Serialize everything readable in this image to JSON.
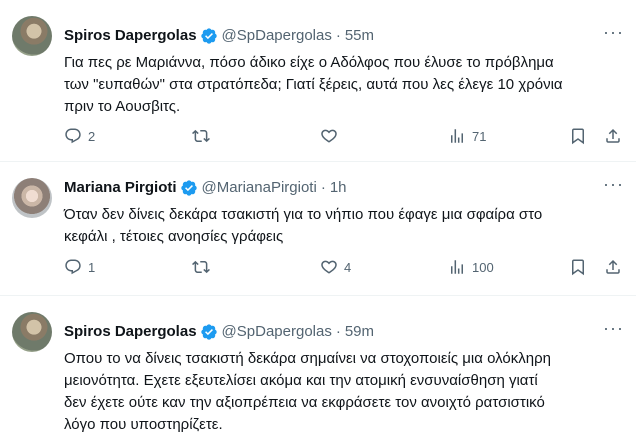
{
  "tweets": [
    {
      "name": "Spiros Dapergolas",
      "handle": "@SpDapergolas",
      "separator": "·",
      "time": "55m",
      "text": "Για πες ρε Μαριάννα, πόσο άδικο είχε ο Αδόλφος που έλυσε το πρόβλημα\nτων \"ευπαθών\" στα στρατόπεδα; Γιατί ξέρεις, αυτά που λες έλεγε 10 χρόνια\nπριν το Αουσβιτς.",
      "replies": "2",
      "retweets": "",
      "likes": "",
      "views": "71"
    },
    {
      "name": "Mariana Pirgioti",
      "handle": "@MarianaPirgioti",
      "separator": "·",
      "time": "1h",
      "text": "Όταν  δεν δίνεις δεκάρα τσακιστή για το νήπιο που έφαγε μια σφαίρα στο\nκεφάλι , τέτοιες ανοησίες γράφεις",
      "replies": "1",
      "retweets": "",
      "likes": "4",
      "views": "100"
    },
    {
      "name": "Spiros Dapergolas",
      "handle": "@SpDapergolas",
      "separator": "·",
      "time": "59m",
      "text": "Οπου το να δίνεις τσακιστή δεκάρα σημαίνει να στοχοποιείς μια ολόκληρη\nμειονότητα. Εχετε εξευτελίσει ακόμα και την ατομική ενσυναίσθηση γιατί\nδεν έχετε ούτε καν την αξιοπρέπεια να εκφράσετε τον ανοιχτό ρατσιστικό\nλόγο που υποστηρίζετε."
    }
  ],
  "icons": {
    "verified": "verified-badge-icon",
    "more": "more-icon",
    "reply": "reply-icon",
    "retweet": "retweet-icon",
    "like": "like-icon",
    "views": "views-icon",
    "bookmark": "bookmark-icon",
    "share": "share-icon"
  },
  "more_glyph": "···",
  "colors": {
    "text": "#0f1419",
    "secondary": "#536471",
    "verified": "#1d9bf0",
    "divider": "#eff3f4"
  }
}
